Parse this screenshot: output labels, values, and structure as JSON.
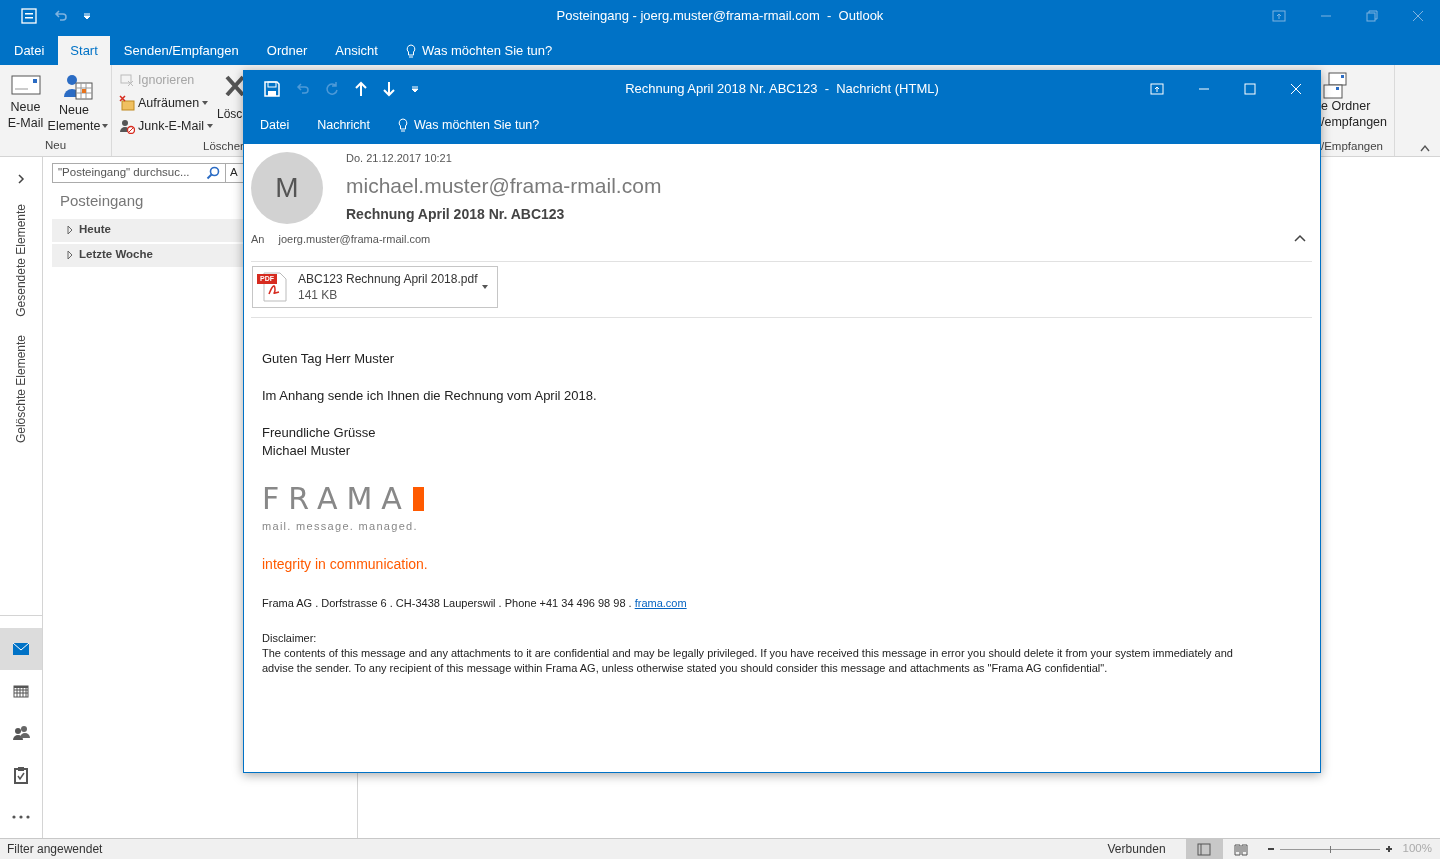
{
  "main_window": {
    "title": "Posteingang - joerg.muster@frama-rmail.com  -  Outlook"
  },
  "ribbon_tabs": [
    {
      "label": "Datei",
      "selected": false
    },
    {
      "label": "Start",
      "selected": true
    },
    {
      "label": "Senden/Empfangen",
      "selected": false
    },
    {
      "label": "Ordner",
      "selected": false
    },
    {
      "label": "Ansicht",
      "selected": false
    }
  ],
  "tell_me": "Was möchten Sie tun?",
  "ribbon": {
    "new_email": "Neue\nE-Mail",
    "new_items": "Neue\nElemente",
    "group_new": "Neu",
    "ignore": {
      "label": "Ignorieren",
      "disabled": true
    },
    "cleanup": "Aufräumen",
    "junk": "Junk-E-Mail",
    "delete_partial": "Lösc",
    "group_delete_partial": "Löscher",
    "send_folder_partial": "e Ordner\n/empfangen",
    "group_send_partial": "/Empfangen"
  },
  "search": {
    "placeholder": "\"Posteingang\" durchsuc...",
    "next_partial": "A"
  },
  "folder_title": "Posteingang",
  "groups": [
    {
      "label": "Heute",
      "expanded": false
    },
    {
      "label": "Letzte Woche",
      "expanded": false
    }
  ],
  "side_folders": [
    "Gesendete Elemente",
    "Gelöschte Elemente"
  ],
  "nav_icons": [
    {
      "kind": "mail",
      "selected": true
    },
    {
      "kind": "calendar",
      "selected": false
    },
    {
      "kind": "people",
      "selected": false
    },
    {
      "kind": "tasks",
      "selected": false
    },
    {
      "kind": "more",
      "selected": false
    }
  ],
  "status_bar": {
    "left": "Filter angewendet",
    "connection": "Verbunden",
    "views": [
      {
        "kind": "normal",
        "selected": true
      },
      {
        "kind": "reading",
        "selected": false
      }
    ],
    "zoom": {
      "level": 0.5,
      "reading": "100%"
    }
  },
  "message_window": {
    "title": "Rechnung April 2018 Nr. ABC123  -  Nachricht (HTML)",
    "menu": [
      "Datei",
      "Nachricht"
    ],
    "tell_me": "Was möchten Sie tun?",
    "avatar_letter": "M",
    "date": "Do. 21.12.2017 10:21",
    "sender": "michael.muster@frama-rmail.com",
    "subject": "Rechnung April 2018 Nr. ABC123",
    "to_label": "An",
    "to": "joerg.muster@frama-rmail.com",
    "attachment": {
      "name": "ABC123 Rechnung April 2018.pdf",
      "size": "141 KB",
      "badge": "PDF"
    },
    "body": [
      "Guten Tag Herr Muster",
      "Im Anhang sende ich Ihnen die Rechnung vom April 2018.",
      "Freundliche Grüsse\nMichael Muster"
    ],
    "logo": {
      "word": "FRAMA",
      "tagline": "mail. message. managed."
    },
    "slogan": "integrity in communication.",
    "address": "Frama AG . Dorfstrasse 6 . CH-3438 Lauperswil . Phone +41 34 496 98 98 . ",
    "address_link": "frama.com",
    "disclaimer_title": "Disclaimer:",
    "disclaimer": "The contents of this message and any attachments to it are confidential and may be legally privileged. If you have received this message in error you should delete it from your system immediately and advise the sender. To any recipient of this message within Frama AG, unless otherwise stated you should consider this message and attachments as \"Frama AG confidential\"."
  }
}
